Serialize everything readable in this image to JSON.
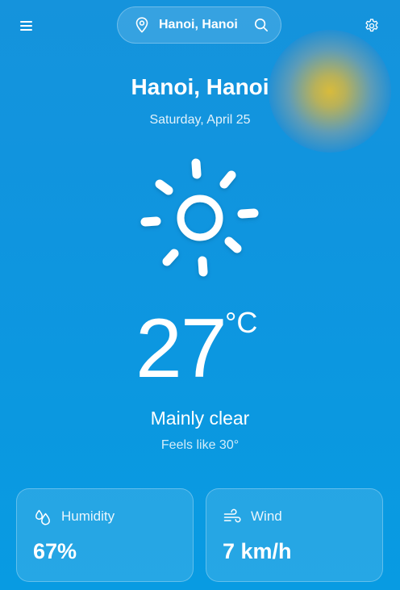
{
  "header": {
    "location": "Hanoi, Hanoi",
    "menu_icon": "menu-icon",
    "settings_icon": "gear-icon",
    "location_icon": "map-pin-icon",
    "search_icon": "search-icon"
  },
  "main": {
    "city": "Hanoi, Hanoi",
    "date": "Saturday, April 25",
    "condition_icon": "sun-icon",
    "temperature": "27",
    "unit": "°C",
    "condition": "Mainly clear",
    "feels_like": "Feels like 30°"
  },
  "cards": {
    "humidity": {
      "label": "Humidity",
      "value": "67%",
      "icon": "droplets-icon"
    },
    "wind": {
      "label": "Wind",
      "value": "7 km/h",
      "icon": "wind-icon"
    }
  },
  "colors": {
    "background": "#1593dc",
    "sun_glow": "#d8bb3c",
    "text": "#ffffff"
  }
}
